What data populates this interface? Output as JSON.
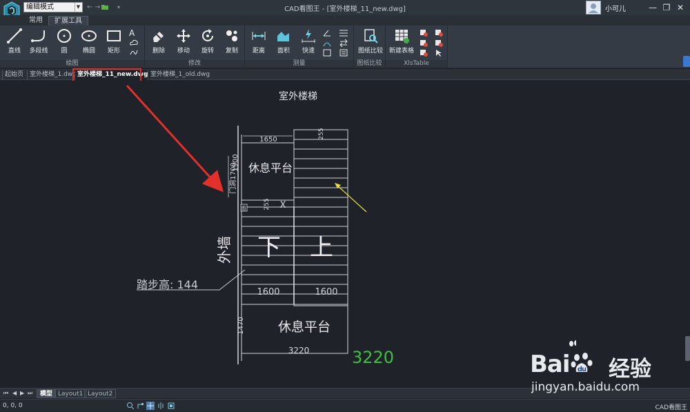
{
  "titlebar": {
    "mode": "编辑模式",
    "window_title": "CAD看图王 - [室外楼梯_11_new.dwg]",
    "user_name": "小可儿",
    "minimize": "—",
    "restore": "❐",
    "close": "✕"
  },
  "ribbon_tabs": [
    "常用",
    "扩展工具"
  ],
  "ribbon": {
    "groups": {
      "draw": "绘图",
      "modify": "修改",
      "measure": "测量",
      "compare": "图纸比较",
      "xls": "XlsTable"
    },
    "buttons": {
      "line": "直线",
      "polyline": "多段线",
      "circle": "圆",
      "ellipse": "椭圆",
      "rect": "矩形",
      "erase": "删除",
      "move": "移动",
      "rotate": "旋转",
      "copy": "复制",
      "distance": "距离",
      "area": "面积",
      "quick": "快速",
      "compare": "图纸比较",
      "new_table": "新建表格"
    },
    "text_glyph": "A"
  },
  "doc_tabs": [
    "起始页",
    "室外楼梯_1.dwg",
    "室外楼梯_11_new.dwg",
    "室外楼梯_1_old.dwg"
  ],
  "drawing": {
    "title": "室外楼梯",
    "dim_1650": "1650",
    "dim_255_top": "255",
    "dim_1900": "1900",
    "door_label": "门洞1700",
    "landing_top": "休息平台",
    "dim_255_mid": "255",
    "mark_x": "X",
    "mark_box": "图",
    "down": "下",
    "up": "上",
    "wall": "外墙",
    "step_height": "踏步高: 144",
    "dim_1600_left": "1600",
    "dim_1600_right": "1600",
    "dim_1470": "1470",
    "landing_bottom": "休息平台",
    "dim_3220": "3220",
    "total_3220": "3220"
  },
  "layout_tabs": [
    "模型",
    "Layout1",
    "Layout2"
  ],
  "status": {
    "coords": "0, 0, 0",
    "app": "CAD看图王"
  },
  "watermark": {
    "baidu": "Bai",
    "du": "du",
    "jingyan": "经验",
    "url": "jingyan.baidu.com"
  },
  "colors": {
    "accent_red": "#e3302a",
    "drawing_line": "#d5d8dc",
    "dim_green": "#3fbf3f",
    "arrow_yellow": "#e8e03a"
  }
}
